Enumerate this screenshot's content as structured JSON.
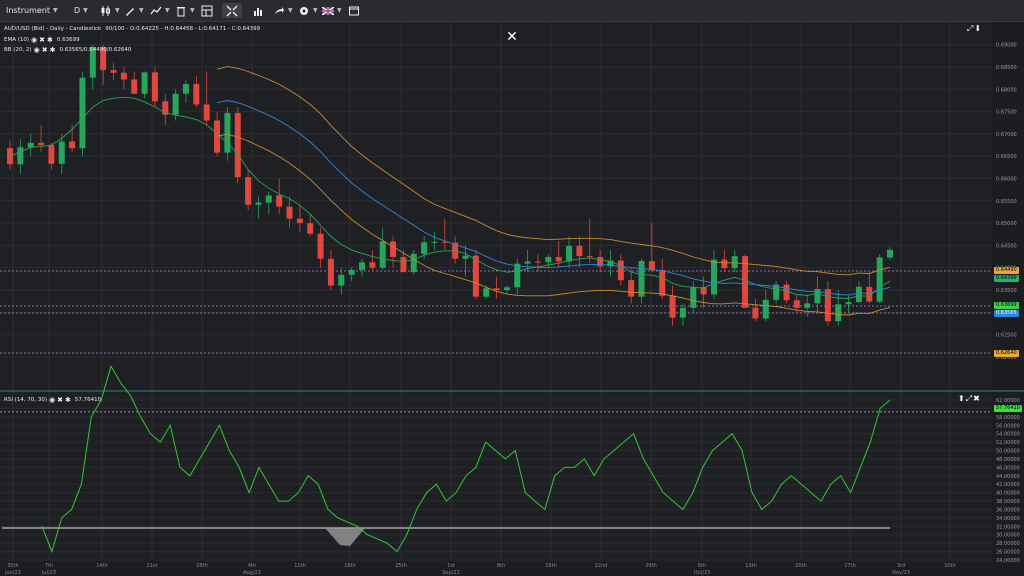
{
  "toolbar": {
    "instrument_label": "Instrument",
    "timeframe_label": "D",
    "items": [
      "candles-icon",
      "bar-style-icon",
      "draw-tools-icon",
      "indicators-icon",
      "trash-icon",
      "layout-icon",
      "fullscreen-icon",
      "chart-type-icon",
      "share-icon",
      "settings-icon",
      "language-flag-icon",
      "window-icon"
    ]
  },
  "header": {
    "title": "AUD/USD (Bid) - Daily - Candlestick",
    "ohlc": "90/100 - O:0.64225 - H:0.64458 - L:0.64171 - C:0.64399",
    "ema_label": "EMA (10)",
    "ema_value": "0.63699",
    "bb_label": "BB (20, 2)",
    "bb_value": "0.63565/0.64490/0.62640"
  },
  "rsi_header": {
    "label": "RSI (14, 70, 30)",
    "value": "57.76410"
  },
  "price_axis": [
    "0.69000",
    "0.68500",
    "0.68000",
    "0.67500",
    "0.67000",
    "0.66500",
    "0.66000",
    "0.65500",
    "0.65000",
    "0.64500",
    "0.64000",
    "0.63500",
    "0.63000",
    "0.62500",
    "0.62000"
  ],
  "price_tags": [
    {
      "text": "0.64490",
      "color": "#e7a93b"
    },
    {
      "text": "0.64399",
      "color": "#25b06b"
    },
    {
      "text": "0.63699",
      "color": "#3fd14a"
    },
    {
      "text": "0.63565",
      "color": "#2f86d6"
    },
    {
      "text": "0.62640",
      "color": "#e7a93b"
    }
  ],
  "rsi_axis": [
    "62.00000",
    "60.00000",
    "58.00000",
    "56.00000",
    "54.00000",
    "52.00000",
    "50.00000",
    "48.00000",
    "46.00000",
    "44.00000",
    "42.00000",
    "40.00000",
    "38.00000",
    "36.00000",
    "34.00000",
    "32.00000",
    "30.00000",
    "28.00000",
    "26.00000",
    "24.00000"
  ],
  "rsi_tag": {
    "text": "57.76410",
    "color": "#38e238"
  },
  "time_axis": [
    {
      "text": "30th",
      "sub": "Jun/23"
    },
    {
      "text": "7th",
      "sub": "Jul/23"
    },
    {
      "text": "14th"
    },
    {
      "text": "21st"
    },
    {
      "text": "28th"
    },
    {
      "text": "4th",
      "sub": "Aug/23"
    },
    {
      "text": "11th"
    },
    {
      "text": "18th"
    },
    {
      "text": "25th"
    },
    {
      "text": "1st",
      "sub": "Sep/23"
    },
    {
      "text": "8th"
    },
    {
      "text": "15th"
    },
    {
      "text": "22nd"
    },
    {
      "text": "29th"
    },
    {
      "text": "6th",
      "sub": "Oct/23"
    },
    {
      "text": "13th"
    },
    {
      "text": "20th"
    },
    {
      "text": "27th"
    },
    {
      "text": "3rd",
      "sub": "Nov/23"
    },
    {
      "text": "10th"
    }
  ],
  "colors": {
    "up": "#26a65b",
    "down": "#e0473d",
    "ema": "#2f86d6",
    "bb": "#c88b2e",
    "rsi": "#32c832"
  },
  "chart_data": {
    "type": "candlestick",
    "candles": [
      [
        0.6668,
        0.6685,
        0.662,
        0.6632
      ],
      [
        0.6632,
        0.6688,
        0.661,
        0.667
      ],
      [
        0.667,
        0.67,
        0.665,
        0.668
      ],
      [
        0.668,
        0.672,
        0.666,
        0.6675
      ],
      [
        0.6675,
        0.668,
        0.662,
        0.6633
      ],
      [
        0.6633,
        0.67,
        0.661,
        0.6683
      ],
      [
        0.6683,
        0.672,
        0.666,
        0.6668
      ],
      [
        0.6668,
        0.684,
        0.665,
        0.6826
      ],
      [
        0.6826,
        0.69,
        0.68,
        0.6895
      ],
      [
        0.6895,
        0.69,
        0.681,
        0.6843
      ],
      [
        0.6843,
        0.686,
        0.682,
        0.6837
      ],
      [
        0.6837,
        0.685,
        0.68,
        0.6822
      ],
      [
        0.6822,
        0.684,
        0.679,
        0.679
      ],
      [
        0.679,
        0.684,
        0.678,
        0.6838
      ],
      [
        0.6838,
        0.685,
        0.676,
        0.6773
      ],
      [
        0.6773,
        0.679,
        0.672,
        0.6743
      ],
      [
        0.6743,
        0.68,
        0.673,
        0.679
      ],
      [
        0.679,
        0.682,
        0.677,
        0.6812
      ],
      [
        0.6812,
        0.683,
        0.676,
        0.6766
      ],
      [
        0.6766,
        0.684,
        0.672,
        0.673
      ],
      [
        0.673,
        0.675,
        0.665,
        0.6658
      ],
      [
        0.6658,
        0.676,
        0.664,
        0.6747
      ],
      [
        0.6747,
        0.676,
        0.659,
        0.6603
      ],
      [
        0.6603,
        0.662,
        0.653,
        0.6541
      ],
      [
        0.6541,
        0.656,
        0.651,
        0.6546
      ],
      [
        0.6546,
        0.657,
        0.652,
        0.6562
      ],
      [
        0.6562,
        0.66,
        0.652,
        0.6537
      ],
      [
        0.6537,
        0.656,
        0.649,
        0.651
      ],
      [
        0.651,
        0.654,
        0.648,
        0.65
      ],
      [
        0.65,
        0.652,
        0.647,
        0.6476
      ],
      [
        0.6476,
        0.649,
        0.64,
        0.642
      ],
      [
        0.642,
        0.644,
        0.635,
        0.636
      ],
      [
        0.636,
        0.64,
        0.634,
        0.6384
      ],
      [
        0.6384,
        0.64,
        0.637,
        0.6395
      ],
      [
        0.6395,
        0.642,
        0.638,
        0.6412
      ],
      [
        0.6412,
        0.644,
        0.6395,
        0.64
      ],
      [
        0.64,
        0.649,
        0.6395,
        0.6459
      ],
      [
        0.6459,
        0.647,
        0.64,
        0.6424
      ],
      [
        0.6424,
        0.644,
        0.639,
        0.639
      ],
      [
        0.639,
        0.644,
        0.6385,
        0.6431
      ],
      [
        0.6431,
        0.647,
        0.642,
        0.6457
      ],
      [
        0.6457,
        0.648,
        0.644,
        0.6458
      ],
      [
        0.6458,
        0.651,
        0.644,
        0.6456
      ],
      [
        0.6456,
        0.647,
        0.641,
        0.642
      ],
      [
        0.642,
        0.645,
        0.638,
        0.6427
      ],
      [
        0.6427,
        0.644,
        0.633,
        0.6335
      ],
      [
        0.6335,
        0.636,
        0.633,
        0.6354
      ],
      [
        0.6354,
        0.638,
        0.633,
        0.635
      ],
      [
        0.635,
        0.636,
        0.634,
        0.6356
      ],
      [
        0.6356,
        0.642,
        0.634,
        0.6409
      ],
      [
        0.6409,
        0.644,
        0.639,
        0.6414
      ],
      [
        0.6414,
        0.643,
        0.639,
        0.6412
      ],
      [
        0.6412,
        0.643,
        0.64,
        0.6424
      ],
      [
        0.6424,
        0.646,
        0.64,
        0.6414
      ],
      [
        0.6414,
        0.647,
        0.64,
        0.6449
      ],
      [
        0.6449,
        0.647,
        0.64,
        0.6426
      ],
      [
        0.6426,
        0.651,
        0.641,
        0.6424
      ],
      [
        0.6424,
        0.644,
        0.639,
        0.6403
      ],
      [
        0.6403,
        0.644,
        0.638,
        0.6416
      ],
      [
        0.6416,
        0.643,
        0.636,
        0.6372
      ],
      [
        0.6372,
        0.64,
        0.632,
        0.6335
      ],
      [
        0.6335,
        0.642,
        0.632,
        0.6415
      ],
      [
        0.6415,
        0.65,
        0.639,
        0.6395
      ],
      [
        0.6395,
        0.642,
        0.633,
        0.6337
      ],
      [
        0.6337,
        0.636,
        0.627,
        0.6288
      ],
      [
        0.6288,
        0.632,
        0.627,
        0.631
      ],
      [
        0.631,
        0.637,
        0.63,
        0.6357
      ],
      [
        0.6357,
        0.638,
        0.631,
        0.634
      ],
      [
        0.634,
        0.644,
        0.633,
        0.6418
      ],
      [
        0.6418,
        0.644,
        0.639,
        0.6399
      ],
      [
        0.6399,
        0.644,
        0.639,
        0.6426
      ],
      [
        0.6426,
        0.643,
        0.633,
        0.631
      ],
      [
        0.631,
        0.633,
        0.628,
        0.6286
      ],
      [
        0.6286,
        0.635,
        0.628,
        0.6328
      ],
      [
        0.6328,
        0.637,
        0.632,
        0.6362
      ],
      [
        0.6362,
        0.637,
        0.632,
        0.6327
      ],
      [
        0.6327,
        0.634,
        0.63,
        0.631
      ],
      [
        0.631,
        0.634,
        0.629,
        0.632
      ],
      [
        0.632,
        0.638,
        0.63,
        0.6352
      ],
      [
        0.6352,
        0.637,
        0.627,
        0.628
      ],
      [
        0.628,
        0.635,
        0.627,
        0.6318
      ],
      [
        0.6318,
        0.634,
        0.63,
        0.6323
      ],
      [
        0.6323,
        0.637,
        0.632,
        0.6357
      ],
      [
        0.6357,
        0.639,
        0.632,
        0.6324
      ],
      [
        0.6324,
        0.643,
        0.632,
        0.6423
      ],
      [
        0.6423,
        0.6446,
        0.6417,
        0.644
      ]
    ],
    "ema": [
      0.665,
      0.666,
      0.667,
      0.6672,
      0.6675,
      0.669,
      0.671,
      0.6735,
      0.676,
      0.6775,
      0.678,
      0.6782,
      0.678,
      0.6772,
      0.676,
      0.6748,
      0.6742,
      0.6738,
      0.6732,
      0.672,
      0.67,
      0.668,
      0.6655,
      0.662,
      0.6595,
      0.6578,
      0.6565,
      0.6555,
      0.654,
      0.652,
      0.6495,
      0.647,
      0.6452,
      0.644,
      0.6432,
      0.6425,
      0.642,
      0.6416,
      0.6414,
      0.6418,
      0.6428,
      0.6435,
      0.6438,
      0.6438,
      0.6432,
      0.6418,
      0.6405,
      0.6395,
      0.639,
      0.6392,
      0.6398,
      0.6402,
      0.6406,
      0.641,
      0.6416,
      0.642,
      0.6422,
      0.6418,
      0.6414,
      0.6405,
      0.639,
      0.6385,
      0.6383,
      0.6378,
      0.6365,
      0.6358,
      0.6356,
      0.6354,
      0.6365,
      0.6372,
      0.6378,
      0.6372,
      0.6362,
      0.6356,
      0.6352,
      0.6348,
      0.634,
      0.6338,
      0.6342,
      0.6335,
      0.6332,
      0.6331,
      0.6337,
      0.6336,
      0.6356,
      0.637
    ],
    "sma": [
      null,
      null,
      null,
      null,
      null,
      null,
      null,
      null,
      null,
      null,
      null,
      null,
      null,
      null,
      null,
      null,
      null,
      null,
      null,
      null,
      0.677,
      0.6775,
      0.677,
      0.6762,
      0.6752,
      0.6742,
      0.673,
      0.6716,
      0.67,
      0.6682,
      0.666,
      0.6635,
      0.6612,
      0.659,
      0.6572,
      0.6555,
      0.654,
      0.6525,
      0.651,
      0.6495,
      0.648,
      0.6468,
      0.646,
      0.6452,
      0.6444,
      0.6436,
      0.6425,
      0.6415,
      0.6408,
      0.6404,
      0.6402,
      0.6401,
      0.64,
      0.6402,
      0.6404,
      0.6406,
      0.6407,
      0.6407,
      0.6406,
      0.6403,
      0.64,
      0.6398,
      0.6396,
      0.6393,
      0.6388,
      0.6382,
      0.6375,
      0.637,
      0.6366,
      0.6365,
      0.6366,
      0.6364,
      0.6362,
      0.636,
      0.6358,
      0.6354,
      0.635,
      0.6347,
      0.6346,
      0.6343,
      0.634,
      0.6339,
      0.6343,
      0.6342,
      0.635,
      0.6356
    ],
    "rsi": [
      32,
      26,
      34,
      36,
      42,
      58,
      62,
      70,
      66,
      63,
      58,
      54,
      52,
      56,
      46,
      44,
      48,
      52,
      56,
      50,
      46,
      40,
      46,
      42,
      38,
      38,
      40,
      44,
      42,
      36,
      34,
      33,
      32,
      30,
      29,
      28,
      26,
      30,
      36,
      40,
      42,
      38,
      40,
      44,
      46,
      52,
      50,
      48,
      50,
      40,
      38,
      36,
      44,
      46,
      46,
      48,
      44,
      48,
      50,
      52,
      54,
      48,
      44,
      40,
      38,
      36,
      40,
      46,
      50,
      52,
      54,
      50,
      40,
      36,
      38,
      42,
      44,
      42,
      40,
      38,
      42,
      44,
      40,
      46,
      52,
      60,
      62
    ]
  }
}
